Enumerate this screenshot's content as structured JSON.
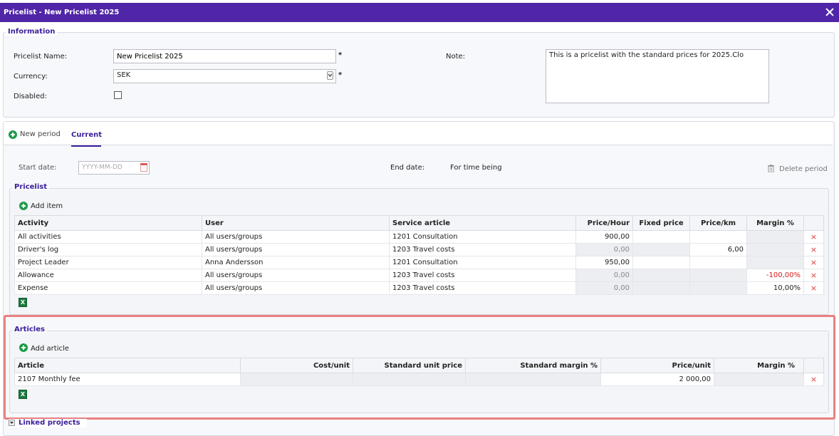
{
  "window": {
    "title": "Pricelist - New Pricelist 2025"
  },
  "information": {
    "legend": "Information",
    "name_label": "Pricelist Name:",
    "name_value": "New Pricelist 2025",
    "required_mark": "*",
    "currency_label": "Currency:",
    "currency_value": "SEK",
    "disabled_label": "Disabled:",
    "note_label": "Note:",
    "note_value": "This is a pricelist with the standard prices for 2025.Clo"
  },
  "tabs": {
    "new_period": "New period",
    "current": "Current"
  },
  "period": {
    "start_label": "Start date:",
    "start_placeholder": "YYYY-MM-DD",
    "end_label": "End date:",
    "end_value": "For time being",
    "delete_label": "Delete period"
  },
  "pricelist": {
    "legend": "Pricelist",
    "add_label": "Add item",
    "columns": [
      "Activity",
      "User",
      "Service article",
      "Price/Hour",
      "Fixed price",
      "Price/km",
      "Margin %"
    ],
    "rows": [
      {
        "activity": "All activities",
        "user": "All users/groups",
        "article": "1201 Consultation",
        "price_hour": "900,00",
        "fixed": "",
        "km": "",
        "margin": ""
      },
      {
        "activity": "Driver's log",
        "user": "All users/groups",
        "article": "1203 Travel costs",
        "price_hour": "0,00",
        "fixed": "",
        "km": "6,00",
        "margin": ""
      },
      {
        "activity": "Project Leader",
        "user": "Anna Andersson",
        "article": "1201 Consultation",
        "price_hour": "950,00",
        "fixed": "",
        "km": "",
        "margin": ""
      },
      {
        "activity": "Allowance",
        "user": "All users/groups",
        "article": "1203 Travel costs",
        "price_hour": "0,00",
        "fixed": "",
        "km": "",
        "margin": "-100,00%"
      },
      {
        "activity": "Expense",
        "user": "All users/groups",
        "article": "1203 Travel costs",
        "price_hour": "0,00",
        "fixed": "",
        "km": "",
        "margin": "10,00%"
      }
    ]
  },
  "articles": {
    "legend": "Articles",
    "add_label": "Add article",
    "columns": [
      "Article",
      "Cost/unit",
      "Standard unit price",
      "Standard margin %",
      "Price/unit",
      "Margin %"
    ],
    "rows": [
      {
        "article": "2107 Monthly fee",
        "cost": "",
        "std_price": "",
        "std_margin": "",
        "price": "2 000,00",
        "margin": ""
      }
    ]
  },
  "linked_projects": {
    "label": "Linked projects"
  },
  "icons": {
    "delete": "×",
    "excel": "X"
  },
  "colors": {
    "titlebar": "#5025a8",
    "accent": "#3a1e9b",
    "add_green": "#1f9b4a",
    "delete_red": "#d93a3a",
    "negative": "#d21b1b",
    "highlight": "#e98080"
  }
}
